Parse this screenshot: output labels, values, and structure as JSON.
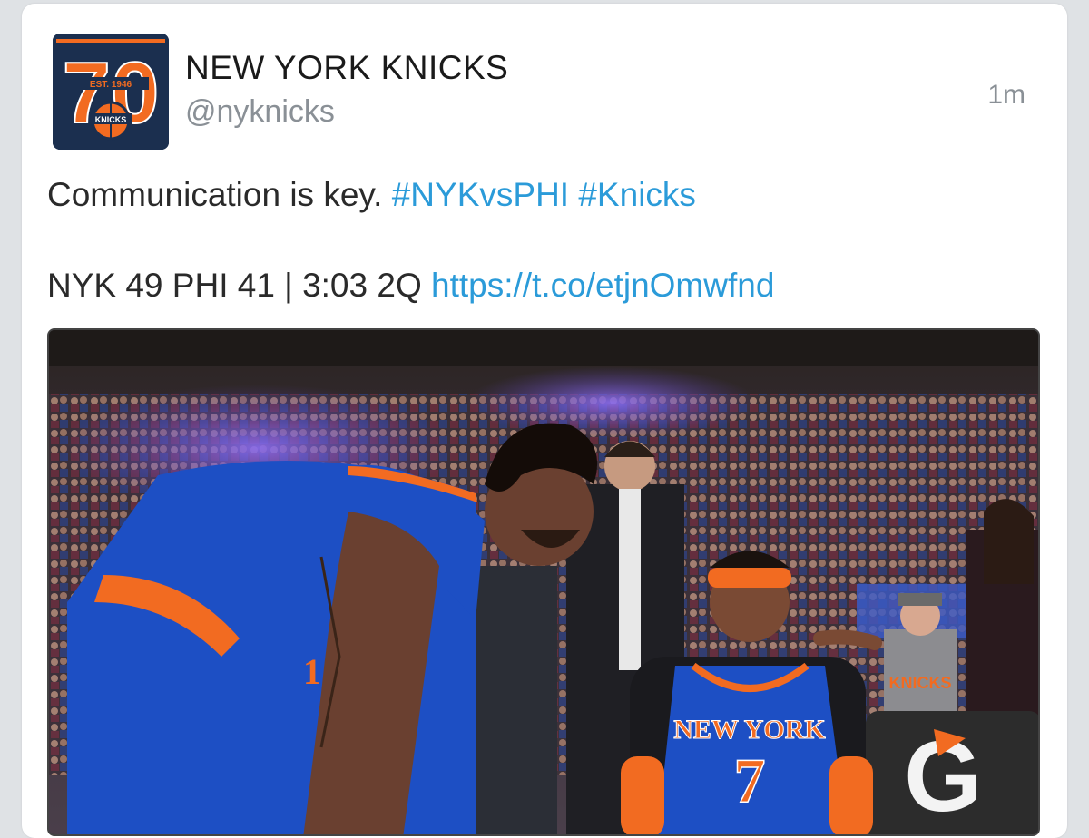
{
  "tweet": {
    "author": {
      "display_name": "NEW YORK KNICKS",
      "handle": "@nyknicks",
      "avatar_text": {
        "big_number": "70",
        "est": "EST. 1946",
        "ball": "KNICKS"
      }
    },
    "timestamp": "1m",
    "text_line_1": {
      "text": "Communication is key.",
      "hashtags": [
        "#NYKvsPHI",
        "#Knicks"
      ]
    },
    "text_line_2": {
      "score_text": "NYK 49 PHI 41 | 3:03 2Q",
      "url": "https://t.co/etjnOmwfnd"
    },
    "photo": {
      "jersey_text": "NEW YORK",
      "jersey_number": "7",
      "partial_jersey_number": "1",
      "bench_logo": "G",
      "fan_shirt": "KNICKS"
    }
  },
  "colors": {
    "link": "#2b9bd9",
    "knicks_blue": "#1d4fc4",
    "knicks_orange": "#f26b21",
    "card_bg": "#ffffff",
    "page_bg": "#dfe2e5"
  }
}
